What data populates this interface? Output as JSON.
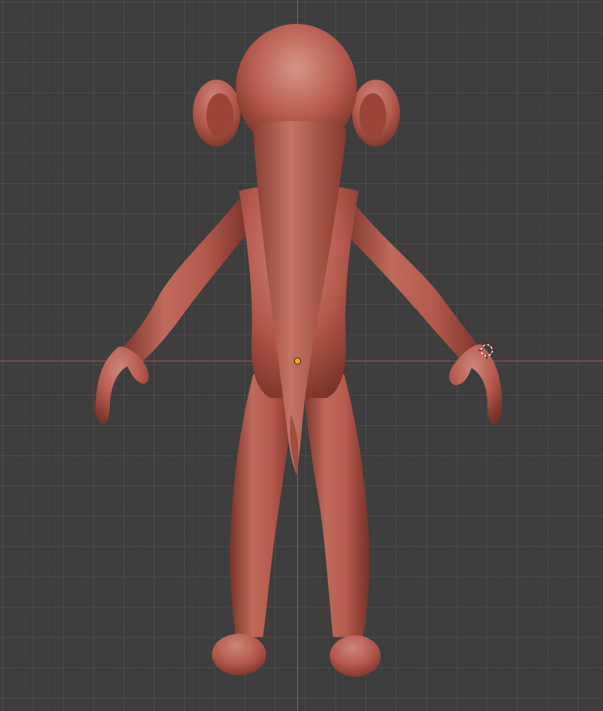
{
  "viewport": {
    "background": "#3d3d3d",
    "grid_color": "#525252",
    "x_axis_color": "#b04a58",
    "y_axis_color": "#4a6fb0"
  },
  "model": {
    "material_color": "#b55a4c",
    "shadow_color": "#7a3328",
    "highlight_color": "#d0857a"
  },
  "cursor": {
    "icon": "3d-cursor-icon",
    "ring_color": "#ffffff",
    "dash_color": "#d9463b"
  },
  "origin": {
    "icon": "object-origin-icon",
    "color": "#f5a623"
  }
}
